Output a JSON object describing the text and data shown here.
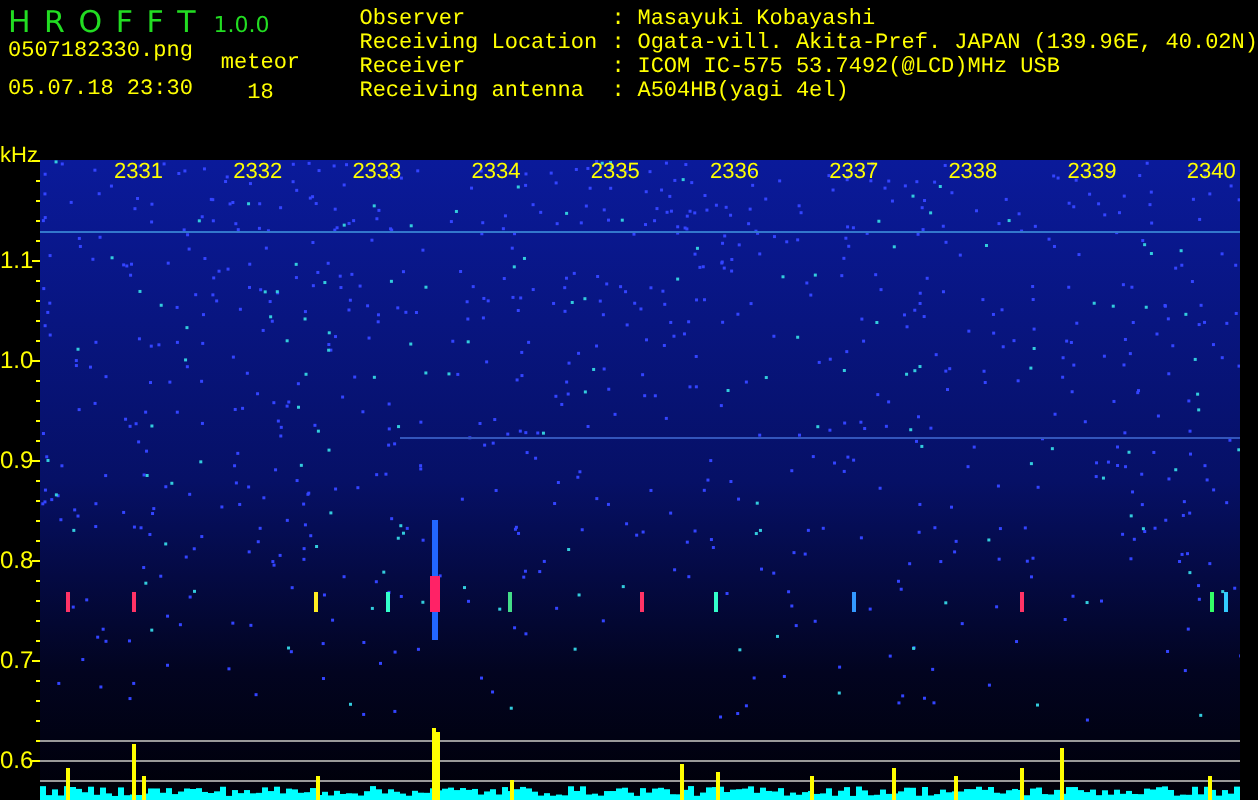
{
  "app": {
    "name": "H R O F F T",
    "version": "1.0.0"
  },
  "file": {
    "name": "0507182330.png",
    "datetime": "05.07.18 23:30"
  },
  "meteor": {
    "label": "meteor",
    "count": "18"
  },
  "info": [
    {
      "label": "Observer",
      "separator": ":",
      "value": "Masayuki Kobayashi"
    },
    {
      "label": "Receiving Location",
      "separator": ":",
      "value": "Ogata-vill. Akita-Pref. JAPAN (139.96E, 40.02N)"
    },
    {
      "label": "Receiver",
      "separator": ":",
      "value": "ICOM IC-575 53.7492(@LCD)MHz USB"
    },
    {
      "label": "Receiving antenna",
      "separator": ":",
      "value": "A504HB(yagi 4el)"
    }
  ],
  "spectrogram": {
    "y_unit": "kHz",
    "y_labels": [
      "1.1",
      "1.0",
      "0.9",
      "0.8",
      "0.7",
      "0.6"
    ],
    "time_labels": [
      "2331",
      "2332",
      "2333",
      "2334",
      "2335",
      "2336",
      "2337",
      "2338",
      "2339",
      "2340"
    ]
  }
}
